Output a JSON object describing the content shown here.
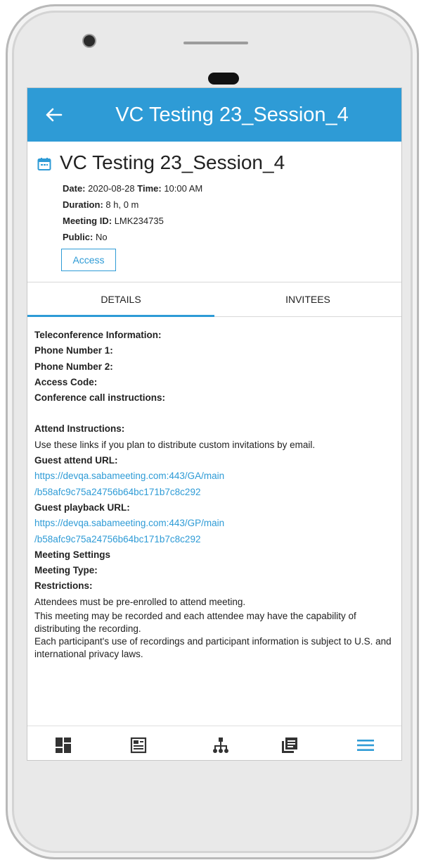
{
  "appbar": {
    "title": "VC Testing 23_Session_4"
  },
  "meeting": {
    "title": "VC Testing 23_Session_4",
    "date_label": "Date:",
    "date": "2020-08-28",
    "time_label": "Time:",
    "time": "10:00 AM",
    "duration_label": "Duration:",
    "duration": "8 h, 0 m",
    "meeting_id_label": "Meeting ID:",
    "meeting_id": "LMK234735",
    "public_label": "Public:",
    "public": "No",
    "access_label": "Access"
  },
  "tabs": [
    {
      "label": "DETAILS",
      "active": true
    },
    {
      "label": "INVITEES",
      "active": false
    }
  ],
  "details": {
    "teleconference_info": "Teleconference Information:",
    "phone1": "Phone Number 1:",
    "phone2": "Phone Number 2:",
    "access_code": "Access Code:",
    "conference_instructions": "Conference call instructions:",
    "attend_instructions": "Attend Instructions:",
    "attend_text": "Use these links if you plan to distribute custom invitations by email.",
    "guest_attend_label": "Guest attend URL:",
    "guest_attend_url_1": "https://devqa.sabameeting.com:443/GA/main",
    "guest_attend_url_2": "/b58afc9c75a24756b64bc171b7c8c292",
    "guest_playback_label": "Guest playback URL:",
    "guest_playback_url_1": "https://devqa.sabameeting.com:443/GP/main",
    "guest_playback_url_2": "/b58afc9c75a24756b64bc171b7c8c292",
    "meeting_settings": "Meeting Settings",
    "meeting_type": "Meeting Type:",
    "restrictions": "Restrictions:",
    "restriction_1": "Attendees must be pre-enrolled to attend meeting.",
    "restriction_2": "This meeting may be recorded and each attendee may have the capability of distributing the recording.",
    "restriction_3": "Each participant's use of recordings and participant information is subject to U.S. and international privacy laws."
  },
  "bottom_nav": [
    {
      "icon": "dashboard-icon"
    },
    {
      "icon": "catalog-icon"
    },
    {
      "icon": "org-chart-icon"
    },
    {
      "icon": "library-icon"
    },
    {
      "icon": "menu-icon",
      "active": true
    }
  ],
  "colors": {
    "accent": "#2e9bd6",
    "nav_icon": "#333333"
  }
}
